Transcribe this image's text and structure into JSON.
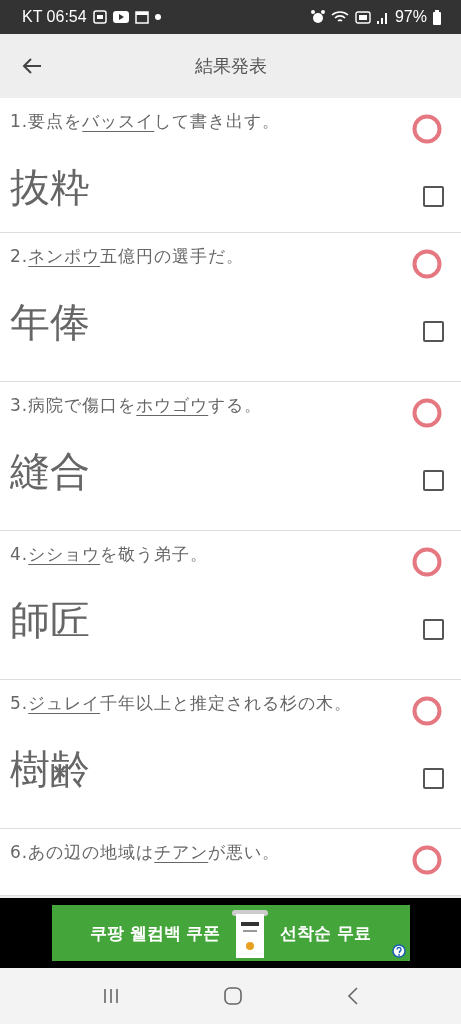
{
  "status_bar": {
    "carrier_time": "KT 06:54",
    "battery": "97%"
  },
  "header": {
    "title": "結果発表"
  },
  "questions": [
    {
      "number": "1.",
      "before": "要点を",
      "underlined": "バッスイ",
      "after": "して書き出す。",
      "answer": "抜粋",
      "correct": true,
      "checked": false
    },
    {
      "number": "2.",
      "underlined": "ネンポウ",
      "after": "五億円の選手だ。",
      "answer": "年俸",
      "correct": true,
      "checked": false
    },
    {
      "number": "3.",
      "before": "病院で傷口を",
      "underlined": "ホウゴウ",
      "after": "する。",
      "answer": "縫合",
      "correct": true,
      "checked": false
    },
    {
      "number": "4.",
      "underlined": "シショウ",
      "after": "を敬う弟子。",
      "answer": "師匠",
      "correct": true,
      "checked": false
    },
    {
      "number": "5.",
      "underlined": "ジュレイ",
      "after": "千年以上と推定される杉の木。",
      "answer": "樹齢",
      "correct": true,
      "checked": false
    },
    {
      "number": "6.",
      "before": "あの辺の地域は",
      "underlined": "チアン",
      "after": "が悪い。",
      "correct": true
    }
  ],
  "ad": {
    "left_text": "쿠팡 웰컴백 쿠폰",
    "right_text": "선착순 무료"
  }
}
